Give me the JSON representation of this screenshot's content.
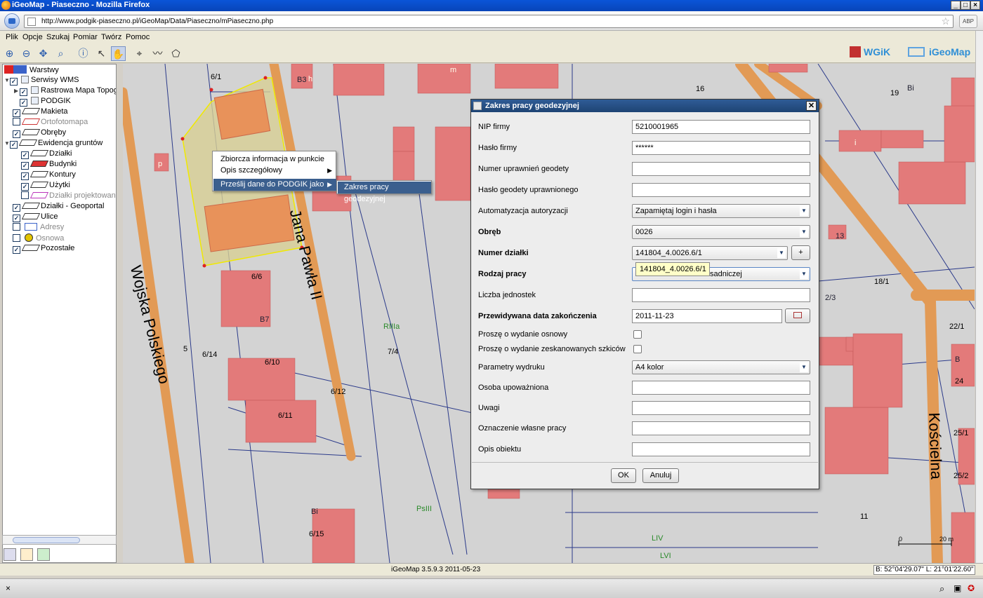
{
  "window": {
    "title": "iGeoMap - Piaseczno - Mozilla Firefox"
  },
  "browser": {
    "url": "http://www.podgik-piaseczno.pl/iGeoMap/Data/Piaseczno/mPiaseczno.php",
    "addon": "ABP"
  },
  "menu": [
    "Plik",
    "Opcje",
    "Szukaj",
    "Pomiar",
    "Twórz",
    "Pomoc"
  ],
  "brand": {
    "wgik": "WGiK",
    "igeomap": "iGeoMap"
  },
  "layers": {
    "root": "Warstwy",
    "items": [
      {
        "label": "Serwisy WMS"
      },
      {
        "label": "Rastrowa Mapa Topog"
      },
      {
        "label": "PODGIK"
      },
      {
        "label": "Makieta"
      },
      {
        "label": "Ortofotomapa"
      },
      {
        "label": "Obręby"
      },
      {
        "label": "Ewidencja gruntów"
      },
      {
        "label": "Działki"
      },
      {
        "label": "Budynki"
      },
      {
        "label": "Kontury"
      },
      {
        "label": "Użytki"
      },
      {
        "label": "Działki projektowane"
      },
      {
        "label": "Działki - Geoportal"
      },
      {
        "label": "Ulice"
      },
      {
        "label": "Adresy"
      },
      {
        "label": "Osnowa"
      },
      {
        "label": "Pozostałe"
      }
    ]
  },
  "map": {
    "streets": [
      "Wojska Polskiego",
      "Jana Pawła II",
      "Kościelna"
    ],
    "labels": [
      "6/1",
      "16",
      "19",
      "Bi",
      "B3",
      "m",
      "h",
      "p",
      "i",
      "13",
      "2/3",
      "18/1",
      "22/1",
      "B",
      "24",
      "25/1",
      "25/2",
      "6/6",
      "6/14",
      "6/10",
      "6/11",
      "6/12",
      "5",
      "7/4",
      "RIIIa",
      "RIIIa",
      "RIIIa",
      "PsIII",
      "LIV",
      "LVI",
      "Bi",
      "6/15",
      "11",
      "B7",
      "0",
      "20 m"
    ]
  },
  "context_menu": {
    "items": [
      "Zbiorcza informacja w punkcie",
      "Opis szczegółowy",
      "Prześlij dane do PODGIK jako"
    ],
    "submenu": "Zakres pracy geodezyjnej"
  },
  "dialog": {
    "title": "Zakres pracy geodezyjnej",
    "fields": [
      {
        "label": "NIP firmy",
        "value": "5210001965"
      },
      {
        "label": "Hasło firmy",
        "value": "******"
      },
      {
        "label": "Numer uprawnień geodety",
        "value": ""
      },
      {
        "label": "Hasło geodety uprawnionego",
        "value": ""
      },
      {
        "label": "Automatyzacja autoryzacji",
        "value": "Zapamiętaj login i hasła"
      },
      {
        "label": "Obręb",
        "value": "0026"
      },
      {
        "label": "Numer działki",
        "value": "141804_4.0026.6/1",
        "add": "+"
      },
      {
        "label": "Rodzaj pracy",
        "value": "sadniczej"
      },
      {
        "label": "Liczba jednostek",
        "value": ""
      },
      {
        "label": "Przewidywana data zakończenia",
        "value": "2011-11-23"
      },
      {
        "label": "Proszę o wydanie osnowy",
        "value": ""
      },
      {
        "label": "Proszę o wydanie zeskanowanych szkiców",
        "value": ""
      },
      {
        "label": "Parametry wydruku",
        "value": "A4 kolor"
      },
      {
        "label": "Osoba upoważniona",
        "value": ""
      },
      {
        "label": "Uwagi",
        "value": ""
      },
      {
        "label": "Oznaczenie własne pracy",
        "value": ""
      },
      {
        "label": "Opis obiektu",
        "value": ""
      }
    ],
    "tooltip": "141804_4.0026.6/1",
    "ok": "OK",
    "cancel": "Anuluj"
  },
  "status": {
    "version": "iGeoMap 3.5.9.3 2011-05-23",
    "coords": "B: 52°04'29.07\" L: 21°01'22.60\""
  }
}
